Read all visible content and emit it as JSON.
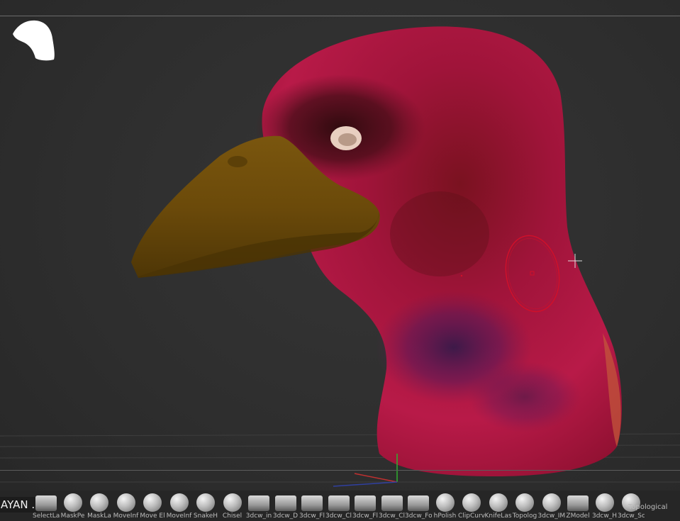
{
  "project": {
    "label": "AYAN ."
  },
  "brushes": [
    {
      "name": "SelectLasso",
      "label": "SelectLa",
      "shape": "sq"
    },
    {
      "name": "MaskPen",
      "label": "MaskPe",
      "shape": "round"
    },
    {
      "name": "MaskLasso",
      "label": "MaskLa",
      "shape": "round"
    },
    {
      "name": "MoveInf",
      "label": "MoveInf",
      "shape": "round"
    },
    {
      "name": "MoveElastic",
      "label": "Move El",
      "shape": "round"
    },
    {
      "name": "MoveInf2",
      "label": "MoveInf",
      "shape": "round"
    },
    {
      "name": "SnakeHook",
      "label": "SnakeH",
      "shape": "round"
    },
    {
      "name": "Chisel",
      "label": "Chisel",
      "shape": "round"
    },
    {
      "name": "3dcw_in",
      "label": "3dcw_in",
      "shape": "sq"
    },
    {
      "name": "3dcw_D",
      "label": "3dcw_D",
      "shape": "sq"
    },
    {
      "name": "3dcw_Fl",
      "label": "3dcw_Fl",
      "shape": "sq"
    },
    {
      "name": "3dcw_Cl",
      "label": "3dcw_Cl",
      "shape": "sq"
    },
    {
      "name": "3dcw_Fl2",
      "label": "3dcw_Fl",
      "shape": "sq"
    },
    {
      "name": "3dcw_Cl2",
      "label": "3dcw_Cl",
      "shape": "sq"
    },
    {
      "name": "3dcw_Fo",
      "label": "3dcw_Fo",
      "shape": "sq"
    },
    {
      "name": "hPolish",
      "label": "hPolish",
      "shape": "round"
    },
    {
      "name": "ClipCurve",
      "label": "ClipCurv",
      "shape": "round"
    },
    {
      "name": "KnifeLasso",
      "label": "KnifeLas",
      "shape": "round"
    },
    {
      "name": "Topology",
      "label": "Topolog",
      "shape": "round"
    },
    {
      "name": "3dcw_IM",
      "label": "3dcw_IM",
      "shape": "round"
    },
    {
      "name": "ZModeler",
      "label": "ZModel",
      "shape": "sq"
    },
    {
      "name": "3dcw_H",
      "label": "3dcw_H",
      "shape": "round"
    },
    {
      "name": "3dcw_Sc",
      "label": "3dcw_Sc",
      "shape": "round"
    }
  ],
  "current_brush": {
    "label": "Topological"
  },
  "colors": {
    "head_red": "#a8143c",
    "head_dark": "#3a0c12",
    "beak": "#6b4a0a",
    "brush_cursor": "#d0102a"
  }
}
